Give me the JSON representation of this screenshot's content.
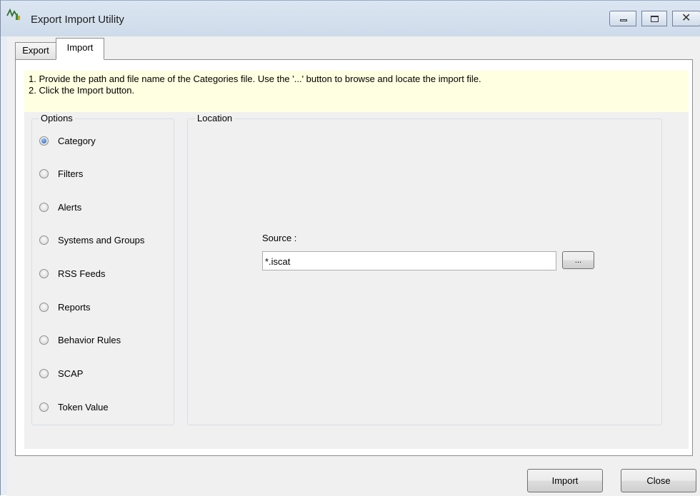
{
  "window": {
    "title": "Export Import Utility",
    "caption_buttons": {
      "minimize": "minimize-icon",
      "maximize": "maximize-icon",
      "close": "✕"
    }
  },
  "tabs": [
    {
      "label": "Export",
      "active": false
    },
    {
      "label": "Import",
      "active": true
    }
  ],
  "instructions": {
    "line1": "1. Provide the path and file name of the Categories file. Use the '...' button to browse and locate the import file.",
    "line2": "2. Click the Import button."
  },
  "options": {
    "legend": "Options",
    "items": [
      {
        "label": "Category",
        "checked": true
      },
      {
        "label": "Filters",
        "checked": false
      },
      {
        "label": "Alerts",
        "checked": false
      },
      {
        "label": "Systems and Groups",
        "checked": false
      },
      {
        "label": "RSS Feeds",
        "checked": false
      },
      {
        "label": "Reports",
        "checked": false
      },
      {
        "label": "Behavior Rules",
        "checked": false
      },
      {
        "label": "SCAP",
        "checked": false
      },
      {
        "label": "Token Value",
        "checked": false
      }
    ]
  },
  "location": {
    "legend": "Location",
    "source_label": "Source :",
    "source_value": "*.iscat",
    "browse_label": "..."
  },
  "footer": {
    "import_label": "Import",
    "close_label": "Close"
  }
}
